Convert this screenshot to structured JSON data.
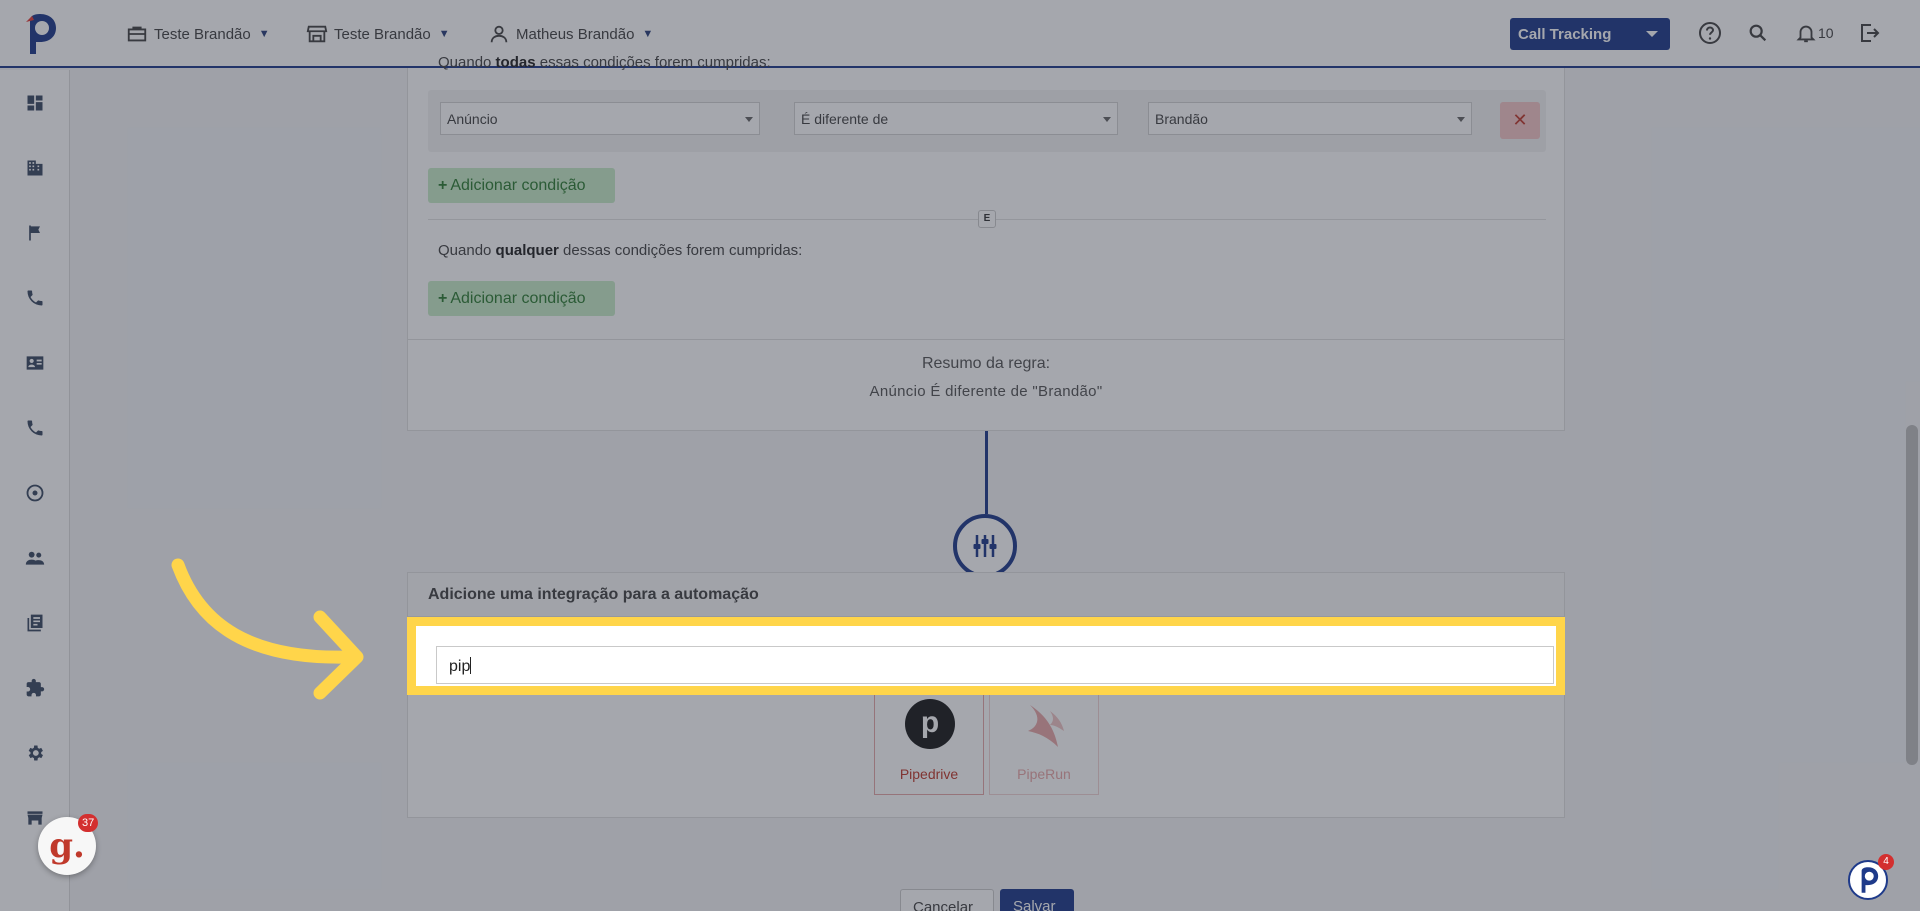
{
  "header": {
    "menus": [
      {
        "label": "Teste Brandão",
        "icon": "briefcase-icon"
      },
      {
        "label": "Teste Brandão",
        "icon": "store-icon"
      },
      {
        "label": "Matheus Brandão",
        "icon": "user-icon"
      }
    ],
    "product_select": "Call Tracking",
    "notifications_count": "10"
  },
  "sidebar": {
    "items": [
      {
        "icon": "dashboard-icon"
      },
      {
        "icon": "building-icon"
      },
      {
        "icon": "flag-icon"
      },
      {
        "icon": "phone-icon"
      },
      {
        "icon": "contact-card-icon"
      },
      {
        "icon": "phone-icon"
      },
      {
        "icon": "dial-icon"
      },
      {
        "icon": "users-icon"
      },
      {
        "icon": "library-icon"
      },
      {
        "icon": "puzzle-icon"
      },
      {
        "icon": "gear-icon"
      },
      {
        "icon": "store-icon"
      }
    ]
  },
  "rule": {
    "all_conditions_prefix": "Quando ",
    "all_conditions_bold": "todas",
    "all_conditions_suffix": " essas condições forem cumpridas:",
    "condition": {
      "field": "Anúncio",
      "operator": "É diferente de",
      "value": "Brandão"
    },
    "add_condition_label": "Adicionar condição",
    "separator": "E",
    "any_conditions_prefix": "Quando ",
    "any_conditions_bold": "qualquer",
    "any_conditions_suffix": " dessas condições forem cumpridas:",
    "summary_title": "Resumo da regra:",
    "summary_text": "Anúncio É diferente de \"Brandão\""
  },
  "integration": {
    "title": "Adicione uma integração para a automação",
    "search_value": "pip",
    "results": [
      {
        "name": "Pipedrive",
        "color": "#c0392b"
      },
      {
        "name": "PipeRun",
        "color": "#e8a7a7"
      }
    ]
  },
  "actions": {
    "cancel_label": "Cancelar",
    "save_label": "Salvar"
  },
  "widgets": {
    "g_badge_letter": "g.",
    "g_badge_count": "37",
    "p_badge_count": "4"
  },
  "colors": {
    "brand": "#1e3a8a",
    "highlight": "#ffd54a",
    "success_bg": "#c8ecc8",
    "danger": "#c0392b"
  }
}
